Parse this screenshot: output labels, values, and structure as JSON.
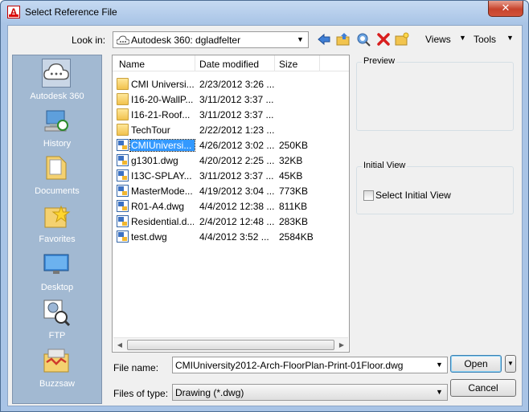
{
  "window": {
    "title": "Select Reference File",
    "close_glyph": "✕"
  },
  "toolbar": {
    "look_in_label": "Look in:",
    "look_in_value": "Autodesk 360:  dgladfelter",
    "views_label": "Views",
    "tools_label": "Tools",
    "icons": [
      "back-arrow-icon",
      "up-folder-icon",
      "search-web-icon",
      "delete-icon",
      "new-folder-icon"
    ]
  },
  "places": [
    {
      "label": "Autodesk 360",
      "icon": "cloud-icon",
      "selected": true
    },
    {
      "label": "History",
      "icon": "history-icon",
      "selected": false
    },
    {
      "label": "Documents",
      "icon": "documents-icon",
      "selected": false
    },
    {
      "label": "Favorites",
      "icon": "favorites-icon",
      "selected": false
    },
    {
      "label": "Desktop",
      "icon": "desktop-icon",
      "selected": false
    },
    {
      "label": "FTP",
      "icon": "ftp-icon",
      "selected": false
    },
    {
      "label": "Buzzsaw",
      "icon": "buzzsaw-icon",
      "selected": false
    }
  ],
  "file_list": {
    "columns": {
      "name": "Name",
      "date": "Date modified",
      "size": "Size"
    },
    "rows": [
      {
        "type": "folder",
        "name": "CMI Universi...",
        "date": "2/23/2012 3:26 ...",
        "size": ""
      },
      {
        "type": "folder",
        "name": "I16-20-WallP...",
        "date": "3/11/2012 3:37 ...",
        "size": ""
      },
      {
        "type": "folder",
        "name": "I16-21-Roof...",
        "date": "3/11/2012 3:37 ...",
        "size": ""
      },
      {
        "type": "folder",
        "name": "TechTour",
        "date": "2/22/2012 1:23 ...",
        "size": ""
      },
      {
        "type": "dwg",
        "name": "CMIUniversi...",
        "date": "4/26/2012 3:02 ...",
        "size": "250KB",
        "selected": true
      },
      {
        "type": "dwg",
        "name": "g1301.dwg",
        "date": "4/20/2012 2:25 ...",
        "size": "32KB"
      },
      {
        "type": "dwg",
        "name": "I13C-SPLAY...",
        "date": "3/11/2012 3:37 ...",
        "size": "45KB"
      },
      {
        "type": "dwg",
        "name": "MasterMode...",
        "date": "4/19/2012 3:04 ...",
        "size": "773KB"
      },
      {
        "type": "dwg",
        "name": "R01-A4.dwg",
        "date": "4/4/2012 12:38 ...",
        "size": "811KB"
      },
      {
        "type": "dwg",
        "name": "Residential.d...",
        "date": "2/4/2012 12:48 ...",
        "size": "283KB"
      },
      {
        "type": "dwg",
        "name": "test.dwg",
        "date": "4/4/2012 3:52 ...",
        "size": "2584KB"
      }
    ]
  },
  "preview": {
    "label": "Preview"
  },
  "initial_view": {
    "label": "Initial View",
    "checkbox_label": "Select Initial View",
    "checked": false
  },
  "file_name": {
    "label": "File name:",
    "value": "CMIUniversity2012-Arch-FloorPlan-Print-01Floor.dwg"
  },
  "files_of_type": {
    "label": "Files of type:",
    "value": "Drawing (*.dwg)"
  },
  "buttons": {
    "open": "Open",
    "cancel": "Cancel"
  }
}
